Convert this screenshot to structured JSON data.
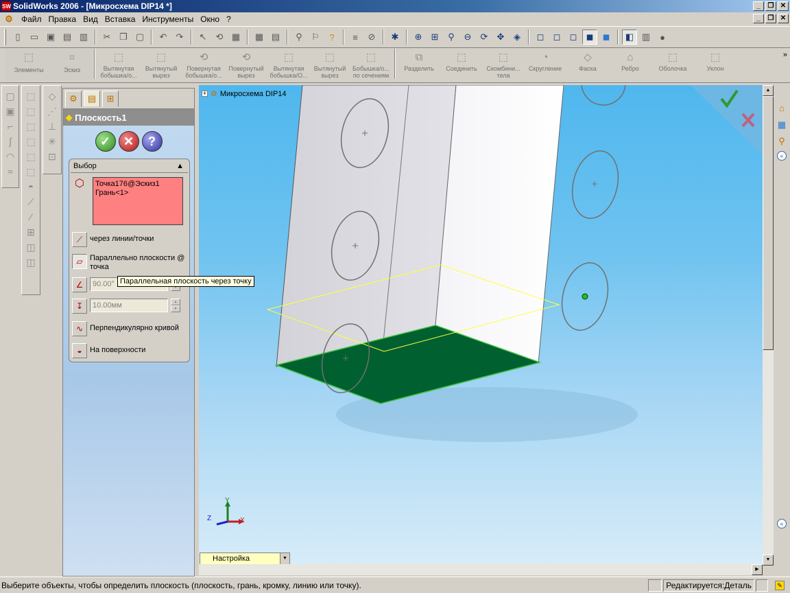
{
  "window": {
    "title": "SolidWorks 2006 - [Микросхема DIP14 *]",
    "app_icon": "SW"
  },
  "menu": [
    "Файл",
    "Правка",
    "Вид",
    "Вставка",
    "Инструменты",
    "Окно",
    "?"
  ],
  "features_toolbar": [
    {
      "label": "Элементы",
      "icon": "elements-icon"
    },
    {
      "label": "Эскиз",
      "icon": "sketch-icon"
    },
    {
      "label": "Вытянутая бобышка/о...",
      "icon": "extruded-boss-icon"
    },
    {
      "label": "Вытянутый вырез",
      "icon": "extruded-cut-icon"
    },
    {
      "label": "Повернутая бобышка/о...",
      "icon": "revolved-boss-icon"
    },
    {
      "label": "Повернутый вырез",
      "icon": "revolved-cut-icon"
    },
    {
      "label": "Вытянутая бобышка/О...",
      "icon": "swept-boss-icon"
    },
    {
      "label": "Вытянутый вырез",
      "icon": "swept-cut-icon"
    },
    {
      "label": "Бобышка/о... по сечениям",
      "icon": "loft-icon"
    },
    {
      "label": "Разделить",
      "icon": "split-icon"
    },
    {
      "label": "Соединить",
      "icon": "join-icon"
    },
    {
      "label": "Скомбини... тела",
      "icon": "combine-icon"
    },
    {
      "label": "Скругление",
      "icon": "fillet-icon"
    },
    {
      "label": "Фаска",
      "icon": "chamfer-icon"
    },
    {
      "label": "Ребро",
      "icon": "rib-icon"
    },
    {
      "label": "Оболочка",
      "icon": "shell-icon"
    },
    {
      "label": "Уклон",
      "icon": "draft-icon"
    }
  ],
  "property_manager": {
    "title": "Плоскость1",
    "selection_group": {
      "title": "Выбор",
      "items": [
        "Точка176@Эскиз1",
        "Грань<1>"
      ]
    },
    "options": {
      "through_lines": "через линии/точки",
      "parallel_plane": "Параллельно плоскости @ точка",
      "angle_value": "90.00°",
      "distance_value": "10.00мм",
      "perpendicular": "Перпендикулярно кривой",
      "on_surface": "На поверхности"
    },
    "tooltip": "Параллельная плоскость через точку"
  },
  "viewport": {
    "tree_root": "Микросхема DIP14",
    "triad": {
      "x": "X",
      "y": "Y",
      "z": "Z"
    },
    "configuration": "Настройка"
  },
  "statusbar": {
    "message": "Выберите объекты, чтобы определить плоскость (плоскость, грань, кромку, линию или точку).",
    "mode": "Редактируется:Деталь"
  },
  "colors": {
    "selection_box": "#ff8080",
    "face_green": "#006030",
    "plane_outline": "#ffff40",
    "point_green": "#20c020"
  }
}
